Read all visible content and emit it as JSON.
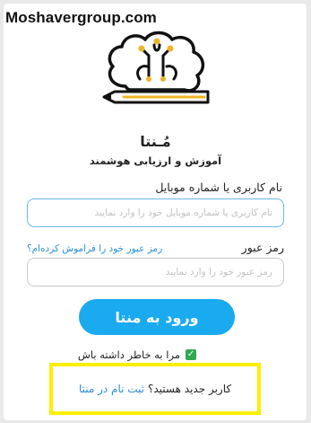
{
  "watermark": "Moshavergroup.com",
  "brand": {
    "name": "مُـنتا",
    "tagline": "آموزش و ارزیابی هوشمند"
  },
  "form": {
    "username_label": "نام کاربری یا شماره موبایل",
    "username_placeholder": "نام کاربری یا شماره موبایل خود را وارد نمایید",
    "username_value": "",
    "password_label": "رمز عبور",
    "password_placeholder": "رمز عبور خود را وارد نمایید",
    "password_value": "",
    "forgot_link": "رمز عبور خود را فراموش کرده‌اm؟",
    "login_button": "ورود به منتا",
    "remember_label": "مرا به خاطر داشته باش",
    "remember_checked": true
  },
  "signup": {
    "question": "کاربر جدید هستید؟",
    "link": "ثبت نام در منتا"
  },
  "colors": {
    "accent": "#1aaaf0",
    "link": "#2a8fd6",
    "highlight": "#ffee00",
    "logo_gold": "#f0b429"
  },
  "icons": [
    "brain-pencil-logo",
    "checkbox-checked-icon"
  ]
}
